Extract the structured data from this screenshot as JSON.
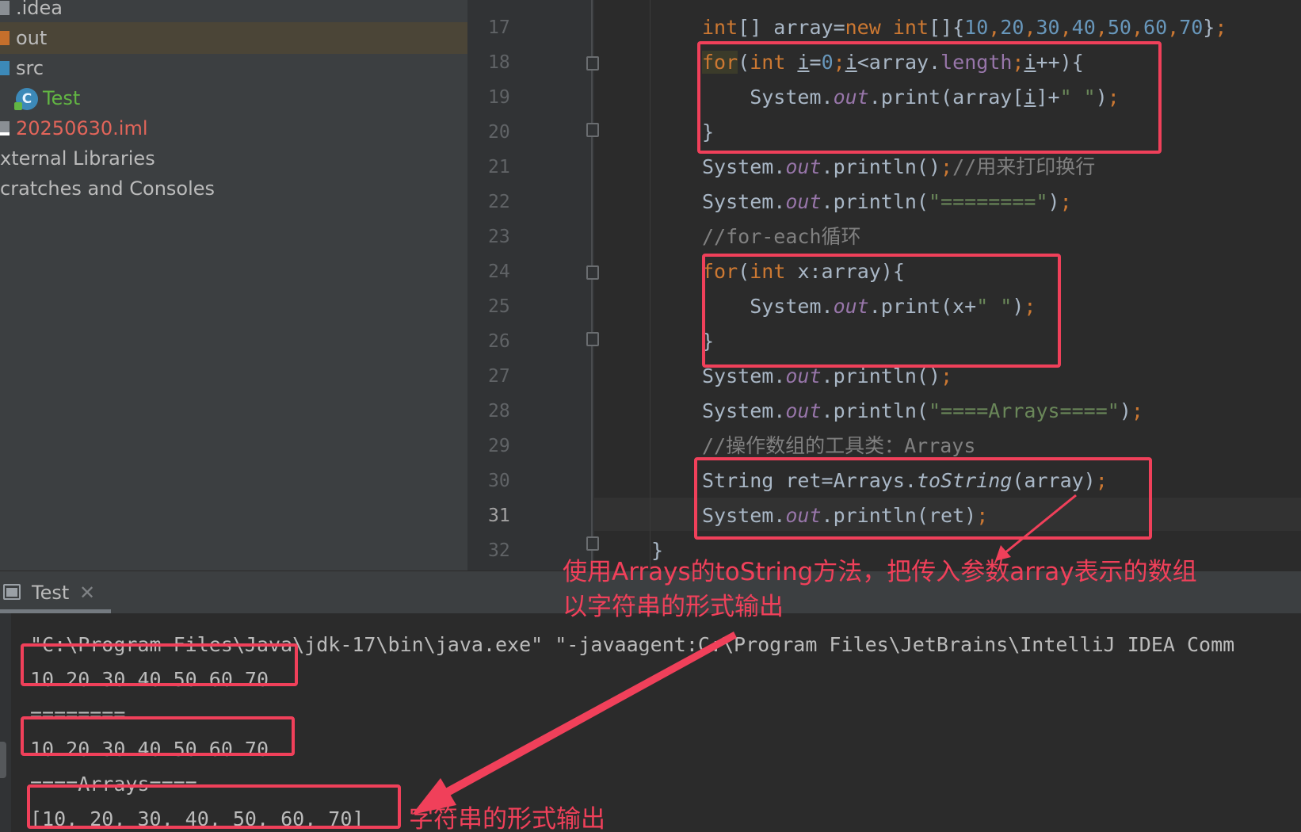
{
  "project_tree": [
    {
      "label": ".idea",
      "icon": "folder-icon",
      "color": "#bbbbbb"
    },
    {
      "label": "out",
      "icon": "folder-icon",
      "color": "#bbbbbb",
      "selected": true
    },
    {
      "label": "src",
      "icon": "folder-icon",
      "color": "#bbbbbb"
    },
    {
      "label": "Test",
      "icon": "java-class-icon",
      "icon_letter": "C",
      "color": "#62b543"
    },
    {
      "label": "20250630.iml",
      "icon": "module-file-icon",
      "color": "#e2655a"
    },
    {
      "label": "xternal Libraries",
      "icon": "",
      "color": "#bbbbbb"
    },
    {
      "label": "cratches and Consoles",
      "icon": "",
      "color": "#bbbbbb"
    }
  ],
  "editor": {
    "line_numbers": [
      "17",
      "18",
      "19",
      "20",
      "21",
      "22",
      "23",
      "24",
      "25",
      "26",
      "27",
      "28",
      "29",
      "30",
      "31",
      "32"
    ],
    "active_line": "31",
    "code_lines": [
      [
        [
          "kw",
          "int"
        ],
        [
          "",
          "[] array="
        ],
        [
          "kw",
          "new "
        ],
        [
          "kw",
          "int"
        ],
        [
          "",
          "[]{"
        ],
        [
          "num",
          "10"
        ],
        [
          "kw",
          ","
        ],
        [
          "num",
          "20"
        ],
        [
          "kw",
          ","
        ],
        [
          "num",
          "30"
        ],
        [
          "kw",
          ","
        ],
        [
          "num",
          "40"
        ],
        [
          "kw",
          ","
        ],
        [
          "num",
          "50"
        ],
        [
          "kw",
          ","
        ],
        [
          "num",
          "60"
        ],
        [
          "kw",
          ","
        ],
        [
          "num",
          "70"
        ],
        [
          "",
          "}"
        ],
        [
          "kw",
          ";"
        ]
      ],
      [
        [
          "kw hl-for",
          "for"
        ],
        [
          "",
          "("
        ],
        [
          "kw",
          "int "
        ],
        [
          "u",
          "i"
        ],
        [
          "",
          "="
        ],
        [
          "num",
          "0"
        ],
        [
          "kw",
          ";"
        ],
        [
          "u",
          "i"
        ],
        [
          "",
          "<array."
        ],
        [
          "prop",
          "length"
        ],
        [
          "kw",
          ";"
        ],
        [
          "u",
          "i"
        ],
        [
          "",
          "++){"
        ]
      ],
      [
        [
          "",
          "    System."
        ],
        [
          "field",
          "out"
        ],
        [
          "",
          ".print(array["
        ],
        [
          "u",
          "i"
        ],
        [
          "",
          "]+"
        ],
        [
          "str",
          "\" \""
        ],
        [
          "",
          ")"
        ],
        [
          "kw",
          ";"
        ]
      ],
      [
        [
          "",
          "}"
        ]
      ],
      [
        [
          "",
          "System."
        ],
        [
          "field",
          "out"
        ],
        [
          "",
          ".println()"
        ],
        [
          "kw",
          ";"
        ],
        [
          "cmt",
          "//用来打印换行"
        ]
      ],
      [
        [
          "",
          "System."
        ],
        [
          "field",
          "out"
        ],
        [
          "",
          ".println("
        ],
        [
          "str",
          "\"========\""
        ],
        [
          "",
          ")"
        ],
        [
          "kw",
          ";"
        ]
      ],
      [
        [
          "cmt",
          "//for-each循环"
        ]
      ],
      [
        [
          "kw",
          "for"
        ],
        [
          "",
          "("
        ],
        [
          "kw",
          "int "
        ],
        [
          "",
          "x:array){"
        ]
      ],
      [
        [
          "",
          "    System."
        ],
        [
          "field",
          "out"
        ],
        [
          "",
          ".print(x+"
        ],
        [
          "str",
          "\" \""
        ],
        [
          "",
          ")"
        ],
        [
          "kw",
          ";"
        ]
      ],
      [
        [
          "",
          "}"
        ]
      ],
      [
        [
          "",
          "System."
        ],
        [
          "field",
          "out"
        ],
        [
          "",
          ".println()"
        ],
        [
          "kw",
          ";"
        ]
      ],
      [
        [
          "",
          "System."
        ],
        [
          "field",
          "out"
        ],
        [
          "",
          ".println("
        ],
        [
          "str",
          "\"====Arrays====\""
        ],
        [
          "",
          ")"
        ],
        [
          "kw",
          ";"
        ]
      ],
      [
        [
          "cmt",
          "//操作数组的工具类：Arrays"
        ]
      ],
      [
        [
          "",
          "String ret=Arrays."
        ],
        [
          "call-i",
          "toString"
        ],
        [
          "",
          "(array)"
        ],
        [
          "kw",
          ";"
        ]
      ],
      [
        [
          "",
          "System."
        ],
        [
          "field",
          "out"
        ],
        [
          "",
          ".println(ret)"
        ],
        [
          "kw",
          ";"
        ]
      ],
      [
        [
          "",
          "}"
        ]
      ]
    ]
  },
  "run_panel": {
    "tab_label": "Test",
    "close_glyph": "✕",
    "console_lines": [
      "\"C:\\Program Files\\Java\\jdk-17\\bin\\java.exe\" \"-javaagent:C:\\Program Files\\JetBrains\\IntelliJ IDEA Comm",
      "10 20 30 40 50 60 70",
      "========",
      "10 20 30 40 50 60 70",
      "====Arrays====",
      "[10, 20, 30, 40, 50, 60, 70]"
    ]
  },
  "annotations": {
    "tostring_note_line1": "使用Arrays的toString方法，把传入参数array表示的数组",
    "tostring_note_line2": "以字符串的形式输出",
    "output_note": "字符串的形式输出",
    "accent_color": "#f0405a"
  },
  "colors": {
    "keyword": "#cc7832",
    "number": "#6897bb",
    "string": "#6a8759",
    "field": "#9876aa",
    "comment": "#808080",
    "text": "#a9b7c6"
  }
}
